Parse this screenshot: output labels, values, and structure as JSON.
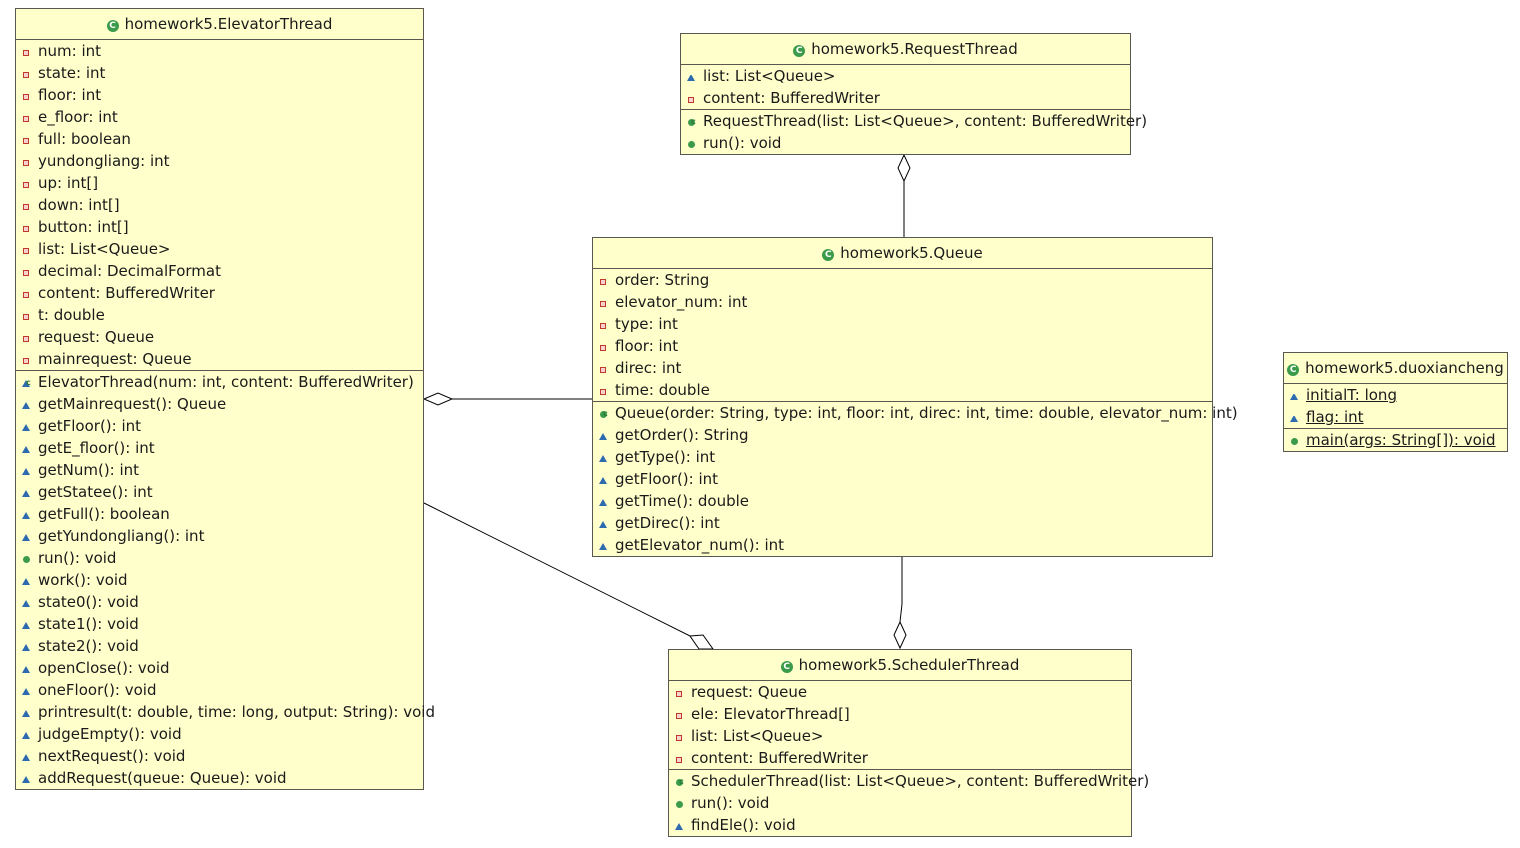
{
  "colors": {
    "box_fill": "#ffffcc",
    "box_border": "#585850",
    "class_icon": "#3b9b4b",
    "private": "#c0392b",
    "package": "#2e6ab0",
    "public": "#3b9b4b"
  },
  "classes": {
    "elevator": {
      "title": "homework5.ElevatorThread",
      "attributes": [
        {
          "vis": "private",
          "text": "num: int"
        },
        {
          "vis": "private",
          "text": "state: int"
        },
        {
          "vis": "private",
          "text": "floor: int"
        },
        {
          "vis": "private",
          "text": "e_floor: int"
        },
        {
          "vis": "private",
          "text": "full: boolean"
        },
        {
          "vis": "private",
          "text": "yundongliang: int"
        },
        {
          "vis": "private",
          "text": "up: int[]"
        },
        {
          "vis": "private",
          "text": "down: int[]"
        },
        {
          "vis": "private",
          "text": "button: int[]"
        },
        {
          "vis": "private",
          "text": "list: List<Queue>"
        },
        {
          "vis": "private",
          "text": "decimal: DecimalFormat"
        },
        {
          "vis": "private",
          "text": "content: BufferedWriter"
        },
        {
          "vis": "private",
          "text": "t: double"
        },
        {
          "vis": "private",
          "text": "request: Queue"
        },
        {
          "vis": "private",
          "text": "mainrequest: Queue"
        }
      ],
      "methods": [
        {
          "vis": "package",
          "ctor": true,
          "text": "ElevatorThread(num: int, content: BufferedWriter)"
        },
        {
          "vis": "package",
          "text": "getMainrequest(): Queue"
        },
        {
          "vis": "package",
          "text": "getFloor(): int"
        },
        {
          "vis": "package",
          "text": "getE_floor(): int"
        },
        {
          "vis": "package",
          "text": "getNum(): int"
        },
        {
          "vis": "package",
          "text": "getStatee(): int"
        },
        {
          "vis": "package",
          "text": "getFull(): boolean"
        },
        {
          "vis": "package",
          "text": "getYundongliang(): int"
        },
        {
          "vis": "public",
          "text": "run(): void"
        },
        {
          "vis": "package",
          "text": "work(): void"
        },
        {
          "vis": "package",
          "text": "state0(): void"
        },
        {
          "vis": "package",
          "text": "state1(): void"
        },
        {
          "vis": "package",
          "text": "state2(): void"
        },
        {
          "vis": "package",
          "text": "openClose(): void"
        },
        {
          "vis": "package",
          "text": "oneFloor(): void"
        },
        {
          "vis": "package",
          "text": "printresult(t: double, time: long, output: String): void"
        },
        {
          "vis": "package",
          "text": "judgeEmpty(): void"
        },
        {
          "vis": "package",
          "text": "nextRequest(): void"
        },
        {
          "vis": "package",
          "text": "addRequest(queue: Queue): void"
        }
      ]
    },
    "request": {
      "title": "homework5.RequestThread",
      "attributes": [
        {
          "vis": "package-attr",
          "text": "list: List<Queue>"
        },
        {
          "vis": "private",
          "text": "content: BufferedWriter"
        }
      ],
      "methods": [
        {
          "vis": "public",
          "ctor": true,
          "text": "RequestThread(list: List<Queue>, content: BufferedWriter)"
        },
        {
          "vis": "public",
          "text": "run(): void"
        }
      ]
    },
    "queue": {
      "title": "homework5.Queue",
      "attributes": [
        {
          "vis": "private",
          "text": "order: String"
        },
        {
          "vis": "private",
          "text": "elevator_num: int"
        },
        {
          "vis": "private",
          "text": "type: int"
        },
        {
          "vis": "private",
          "text": "floor: int"
        },
        {
          "vis": "private",
          "text": "direc: int"
        },
        {
          "vis": "private",
          "text": "time: double"
        }
      ],
      "methods": [
        {
          "vis": "public",
          "ctor": true,
          "text": "Queue(order: String, type: int, floor: int, direc: int, time: double, elevator_num: int)"
        },
        {
          "vis": "package",
          "text": "getOrder(): String"
        },
        {
          "vis": "package",
          "text": "getType(): int"
        },
        {
          "vis": "package",
          "text": "getFloor(): int"
        },
        {
          "vis": "package",
          "text": "getTime(): double"
        },
        {
          "vis": "package",
          "text": "getDirec(): int"
        },
        {
          "vis": "package",
          "text": "getElevator_num(): int"
        }
      ]
    },
    "duo": {
      "title": "homework5.duoxiancheng",
      "attributes": [
        {
          "vis": "package-attr",
          "static": true,
          "text": "initialT: long"
        },
        {
          "vis": "package-attr",
          "static": true,
          "text": "flag: int"
        }
      ],
      "methods": [
        {
          "vis": "public",
          "static": true,
          "text": "main(args: String[]): void"
        }
      ]
    },
    "scheduler": {
      "title": "homework5.SchedulerThread",
      "attributes": [
        {
          "vis": "private",
          "text": "request: Queue"
        },
        {
          "vis": "private",
          "text": "ele: ElevatorThread[]"
        },
        {
          "vis": "private",
          "text": "list: List<Queue>"
        },
        {
          "vis": "private",
          "text": "content: BufferedWriter"
        }
      ],
      "methods": [
        {
          "vis": "public",
          "ctor": true,
          "text": "SchedulerThread(list: List<Queue>, content: BufferedWriter)"
        },
        {
          "vis": "public",
          "text": "run(): void"
        },
        {
          "vis": "package",
          "text": "findEle(): void"
        }
      ]
    }
  }
}
